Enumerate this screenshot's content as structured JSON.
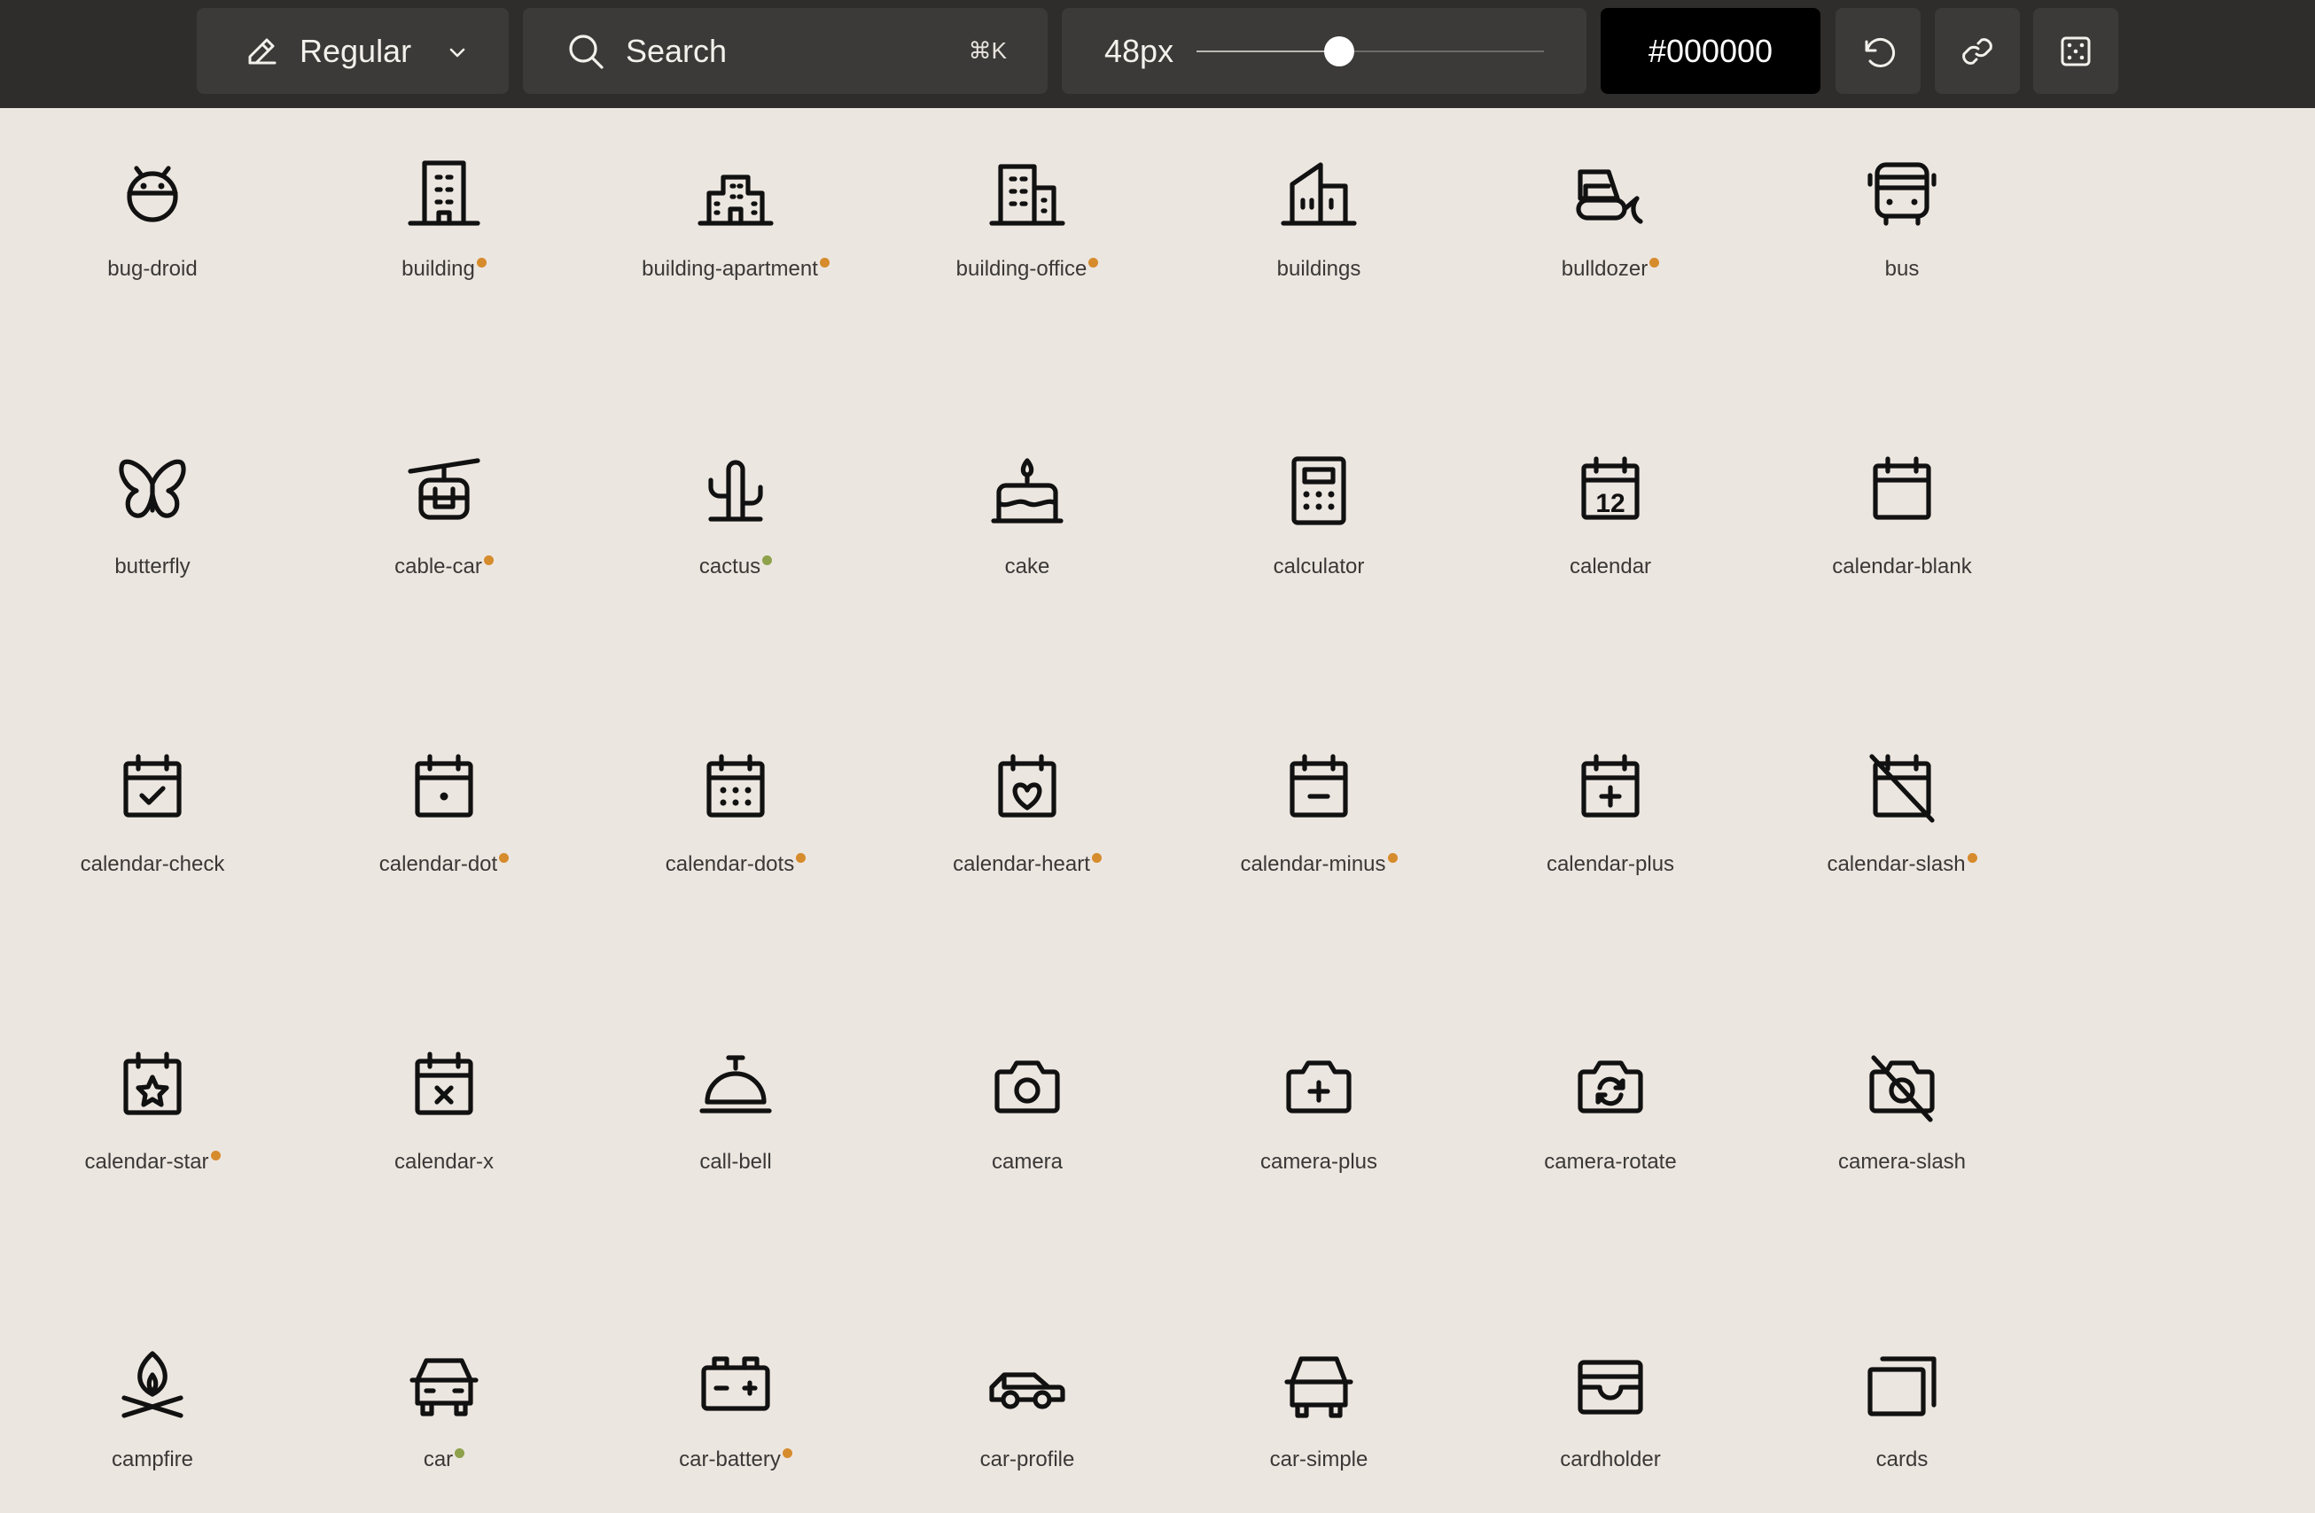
{
  "toolbar": {
    "weight_label": "Regular",
    "weight_icon": "pencil-icon",
    "search_placeholder": "Search",
    "search_shortcut": "⌘K",
    "size_label": "48px",
    "size_slider_fraction": 0.41,
    "color_value": "#000000",
    "reset_icon": "arrow-counter-clockwise-icon",
    "link_icon": "link-icon",
    "random_icon": "dice-icon"
  },
  "colors": {
    "toolbar_bg": "#2e2d2b",
    "control_bg": "#3b3a38",
    "page_bg": "#ece6e0",
    "badge_orange": "#d68b2c",
    "badge_green": "#8ea14b"
  },
  "icons": [
    {
      "name": "bug-droid",
      "badge": ""
    },
    {
      "name": "building",
      "badge": "orange"
    },
    {
      "name": "building-apartment",
      "badge": "orange"
    },
    {
      "name": "building-office",
      "badge": "orange"
    },
    {
      "name": "buildings",
      "badge": ""
    },
    {
      "name": "bulldozer",
      "badge": "orange"
    },
    {
      "name": "bus",
      "badge": ""
    },
    {
      "name": "butterfly",
      "badge": ""
    },
    {
      "name": "cable-car",
      "badge": "orange"
    },
    {
      "name": "cactus",
      "badge": "green"
    },
    {
      "name": "cake",
      "badge": ""
    },
    {
      "name": "calculator",
      "badge": ""
    },
    {
      "name": "calendar",
      "badge": ""
    },
    {
      "name": "calendar-blank",
      "badge": ""
    },
    {
      "name": "calendar-check",
      "badge": ""
    },
    {
      "name": "calendar-dot",
      "badge": "orange"
    },
    {
      "name": "calendar-dots",
      "badge": "orange"
    },
    {
      "name": "calendar-heart",
      "badge": "orange"
    },
    {
      "name": "calendar-minus",
      "badge": "orange"
    },
    {
      "name": "calendar-plus",
      "badge": ""
    },
    {
      "name": "calendar-slash",
      "badge": "orange"
    },
    {
      "name": "calendar-star",
      "badge": "orange"
    },
    {
      "name": "calendar-x",
      "badge": ""
    },
    {
      "name": "call-bell",
      "badge": ""
    },
    {
      "name": "camera",
      "badge": ""
    },
    {
      "name": "camera-plus",
      "badge": ""
    },
    {
      "name": "camera-rotate",
      "badge": ""
    },
    {
      "name": "camera-slash",
      "badge": ""
    },
    {
      "name": "campfire",
      "badge": ""
    },
    {
      "name": "car",
      "badge": "green"
    },
    {
      "name": "car-battery",
      "badge": "orange"
    },
    {
      "name": "car-profile",
      "badge": ""
    },
    {
      "name": "car-simple",
      "badge": ""
    },
    {
      "name": "cardholder",
      "badge": ""
    },
    {
      "name": "cards",
      "badge": ""
    }
  ],
  "calendar_number": "12"
}
